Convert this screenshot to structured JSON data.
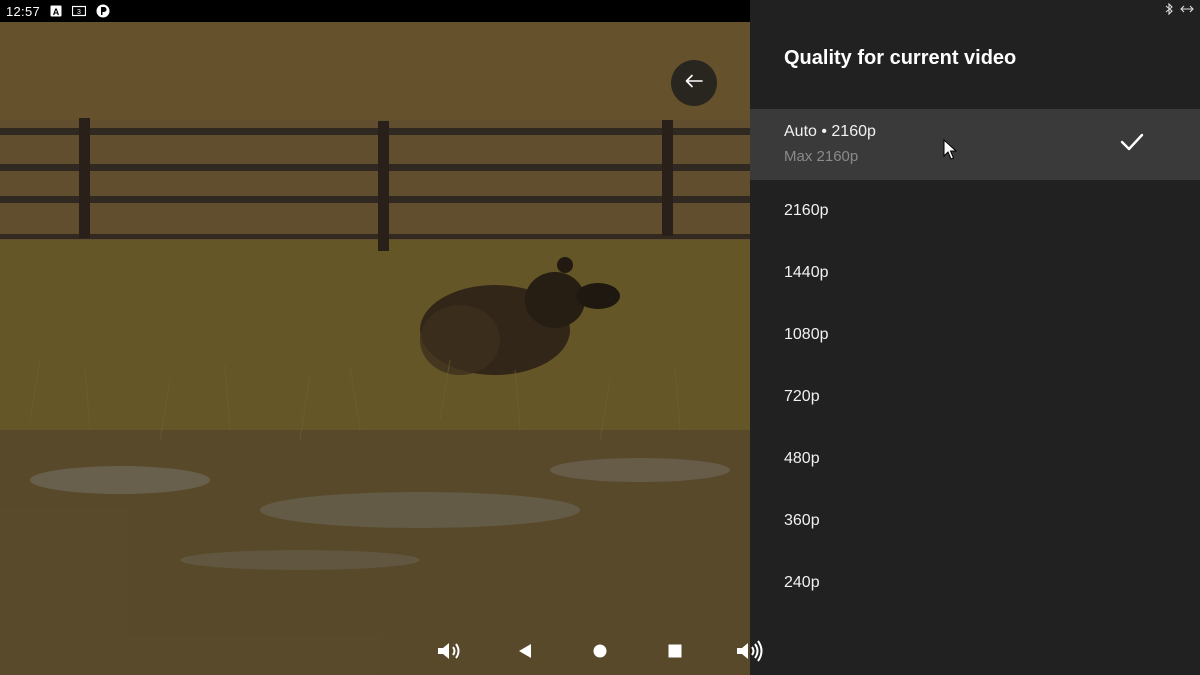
{
  "status_bar": {
    "time": "12:57",
    "icons": [
      "a-notification-icon",
      "screenshot-icon",
      "app-notification-icon"
    ],
    "right_icons": [
      "bluetooth-icon",
      "connection-arrows-icon"
    ]
  },
  "video": {
    "back_icon": "arrow-left-icon"
  },
  "quality_panel": {
    "title": "Quality for current video",
    "selected": {
      "label": "Auto • 2160p",
      "sublabel": "Max 2160p",
      "checked": true
    },
    "options": [
      "2160p",
      "1440p",
      "1080p",
      "720p",
      "480p",
      "360p",
      "240p"
    ]
  },
  "nav_bar": {
    "buttons": [
      "volume-down-icon",
      "back-triangle-icon",
      "home-circle-icon",
      "recents-square-icon",
      "volume-up-icon"
    ]
  },
  "colors": {
    "panel_bg": "#212121",
    "selected_bg": "#3a3a3a",
    "sublabel": "#8a8a8a"
  }
}
